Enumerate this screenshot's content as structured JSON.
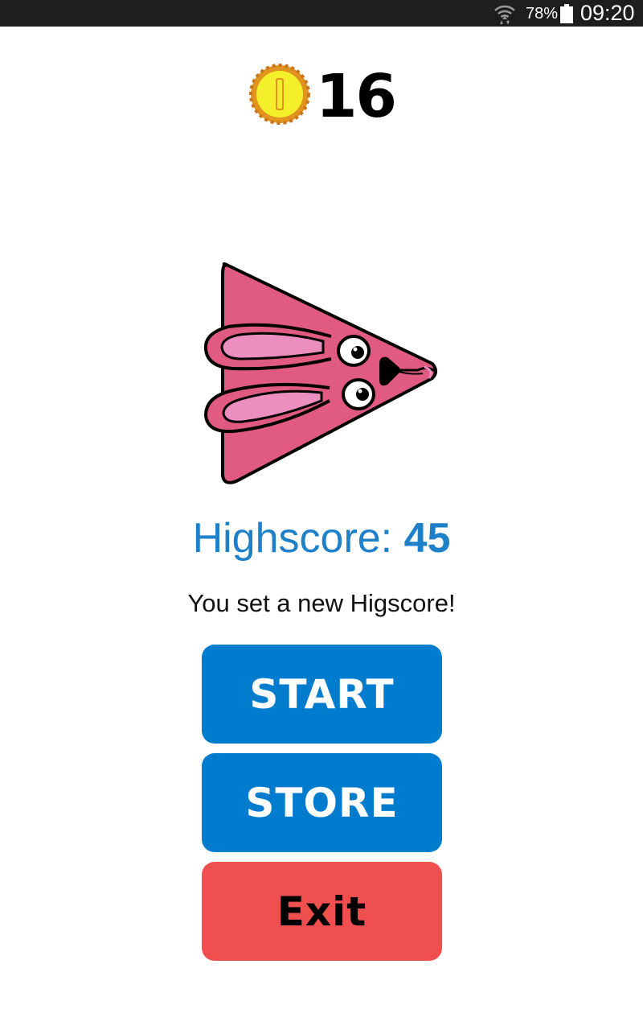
{
  "status_bar": {
    "battery_percent": "78%",
    "time": "09:20",
    "icons": [
      "wifi-icon",
      "battery-icon"
    ]
  },
  "coins": {
    "icon": "coin-icon",
    "count": "16"
  },
  "character": {
    "icon": "pink-bunny-triangle-character"
  },
  "highscore": {
    "label": "Highscore: ",
    "value": "45"
  },
  "message": "You set a new Higscore!",
  "buttons": {
    "start_label": "START",
    "store_label": "STORE",
    "exit_label": "Exit"
  },
  "colors": {
    "status_bar": "#1e1e1e",
    "accent_blue": "#007ccf",
    "highscore_text": "#1e80c8",
    "exit_red": "#ef4f4e",
    "character_pink": "#e05a82",
    "ear_inner_pink": "#ec8fc0",
    "coin_yellow": "#f4ef2a",
    "coin_rim": "#e0941f"
  }
}
